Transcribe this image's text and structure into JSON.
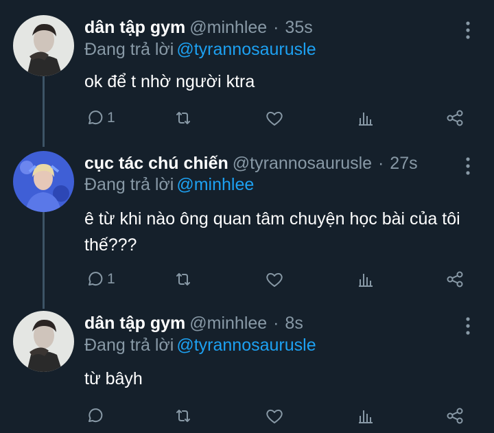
{
  "tweets": [
    {
      "name": "dân tập gym",
      "handle": "@minhlee",
      "separator": "·",
      "time": "35s",
      "reply_prefix": "Đang trả lời",
      "reply_to": "@tyrannosaurusle",
      "text": "ok để t nhờ người ktra",
      "reply_count": "1"
    },
    {
      "name": "cục tác chú chiến",
      "handle": "@tyrannosaurusle",
      "separator": "·",
      "time": "27s",
      "reply_prefix": "Đang trả lời",
      "reply_to": "@minhlee",
      "text": "ê từ khi nào ông quan tâm chuyện học bài của tôi thế???",
      "reply_count": "1"
    },
    {
      "name": "dân tập gym",
      "handle": "@minhlee",
      "separator": "·",
      "time": "8s",
      "reply_prefix": "Đang trả lời",
      "reply_to": "@tyrannosaurusle",
      "text": "từ bâyh",
      "reply_count": ""
    }
  ],
  "colors": {
    "background": "#15202b",
    "secondary_text": "#8899a6",
    "mention": "#1da1f2",
    "thread_line": "#3d5466"
  },
  "icons": [
    "reply-icon",
    "retweet-icon",
    "like-icon",
    "analytics-icon",
    "share-icon",
    "more-icon"
  ]
}
